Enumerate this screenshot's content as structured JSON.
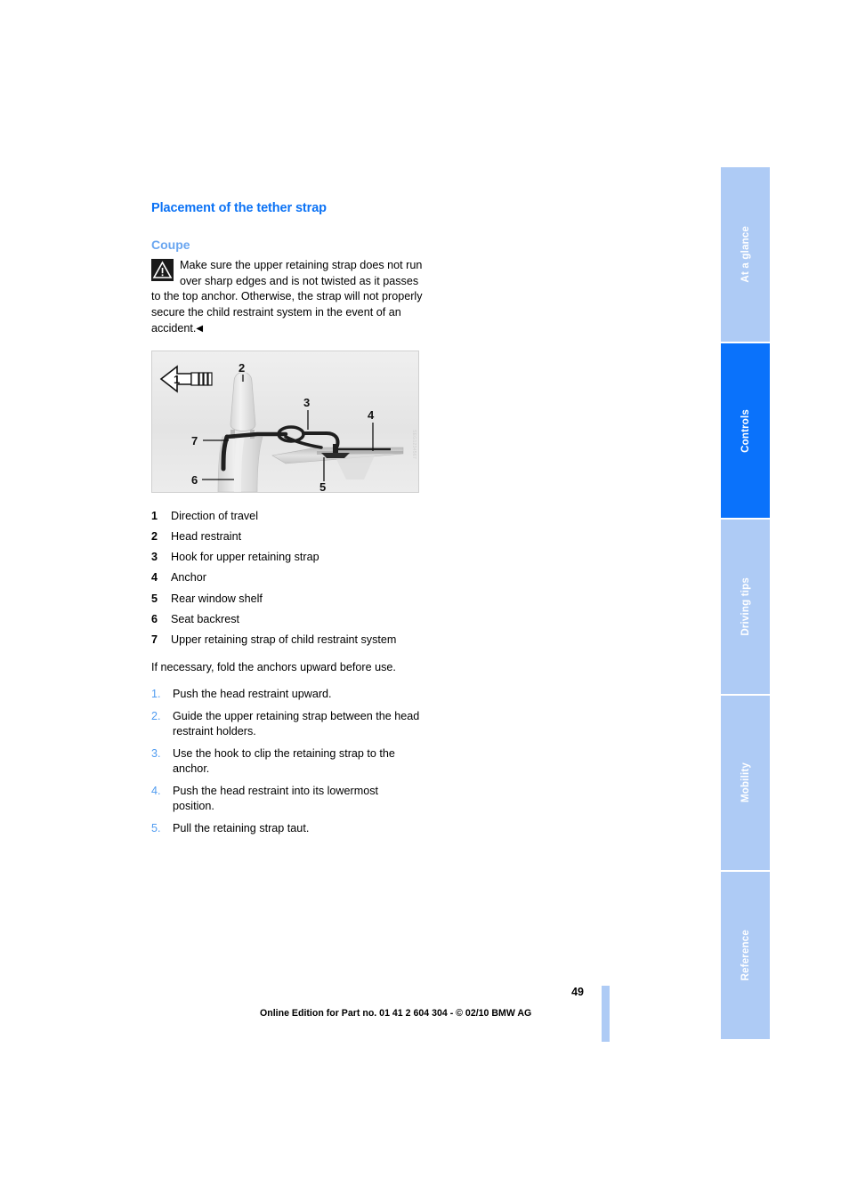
{
  "document": {
    "section_title": "Placement of the tether strap",
    "subsection_title": "Coupe"
  },
  "warning": {
    "icon": "warning-triangle-icon",
    "text": "Make sure the upper retaining strap does not run over sharp edges and is not twisted as it passes to the top anchor. Otherwise, the strap will not properly secure the child restraint system in the event of an accident.",
    "end_marker": "◀"
  },
  "figure": {
    "alt": "Coupe seat with head restraint, upper retaining strap routed to rear window shelf anchor",
    "callouts": [
      "1",
      "2",
      "3",
      "4",
      "5",
      "6",
      "7"
    ],
    "code": "SEG1234567"
  },
  "legend": [
    {
      "num": "1",
      "label": "Direction of travel"
    },
    {
      "num": "2",
      "label": "Head restraint"
    },
    {
      "num": "3",
      "label": "Hook for upper retaining strap"
    },
    {
      "num": "4",
      "label": "Anchor"
    },
    {
      "num": "5",
      "label": "Rear window shelf"
    },
    {
      "num": "6",
      "label": "Seat backrest"
    },
    {
      "num": "7",
      "label": "Upper retaining strap of child restraint system"
    }
  ],
  "note": "If necessary, fold the anchors upward before use.",
  "steps": [
    {
      "num": "1.",
      "text": "Push the head restraint upward."
    },
    {
      "num": "2.",
      "text": "Guide the upper retaining strap between the head restraint holders."
    },
    {
      "num": "3.",
      "text": "Use the hook to clip the retaining strap to the anchor."
    },
    {
      "num": "4.",
      "text": "Push the head restraint into its lowermost position."
    },
    {
      "num": "5.",
      "text": "Pull the retaining strap taut."
    }
  ],
  "rail": {
    "tabs": [
      {
        "label": "At a glance",
        "active": false
      },
      {
        "label": "Controls",
        "active": true
      },
      {
        "label": "Driving tips",
        "active": false
      },
      {
        "label": "Mobility",
        "active": false
      },
      {
        "label": "Reference",
        "active": false
      }
    ]
  },
  "footer": {
    "page_number": "49",
    "note": "Online Edition for Part no. 01 41 2 604 304 - © 02/10 BMW AG"
  },
  "colors": {
    "heading_blue": "#0b72f5",
    "sub_blue": "#6aa6f0",
    "tab_inactive": "#aecbf5",
    "tab_active": "#0a72fb",
    "step_number": "#4f9bf0"
  }
}
